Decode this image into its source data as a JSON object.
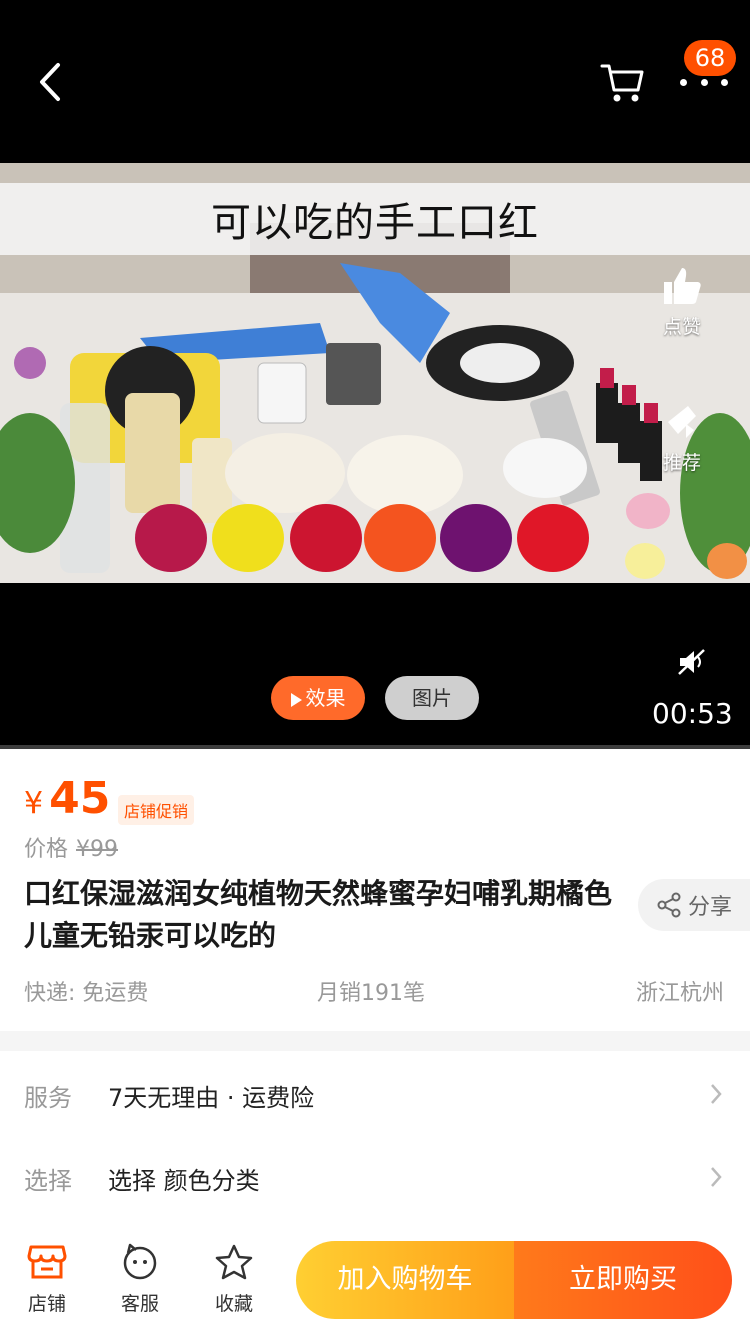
{
  "header": {
    "cart_badge": "68"
  },
  "video": {
    "caption": "可以吃的手工口红",
    "like_label": "点赞",
    "recommend_label": "推荐",
    "duration": "00:53",
    "tabs": {
      "effect_label": "效果",
      "photo_label": "图片"
    },
    "progress": 0.0
  },
  "product": {
    "currency": "¥",
    "price": "45",
    "promo_tag": "店铺促销",
    "original_label": "价格",
    "original_price": "¥99",
    "title": "口红保湿滋润女纯植物天然蜂蜜孕妇哺乳期橘色儿童无铅汞可以吃的",
    "share_label": "分享",
    "shipping": "快递: 免运费",
    "monthly_sales": "月销191笔",
    "location": "浙江杭州"
  },
  "service_row": {
    "label": "服务",
    "value": "7天无理由 · 运费险"
  },
  "select_row": {
    "label": "选择",
    "value": "选择  颜色分类"
  },
  "bottom_bar": {
    "shop_label": "店铺",
    "service_label": "客服",
    "favorite_label": "收藏",
    "add_cart_label": "加入购物车",
    "buy_now_label": "立即购买"
  },
  "colors": {
    "accent": "#ff5000",
    "cart_button": "#ffb31f",
    "buy_button": "#ff5a1b"
  }
}
